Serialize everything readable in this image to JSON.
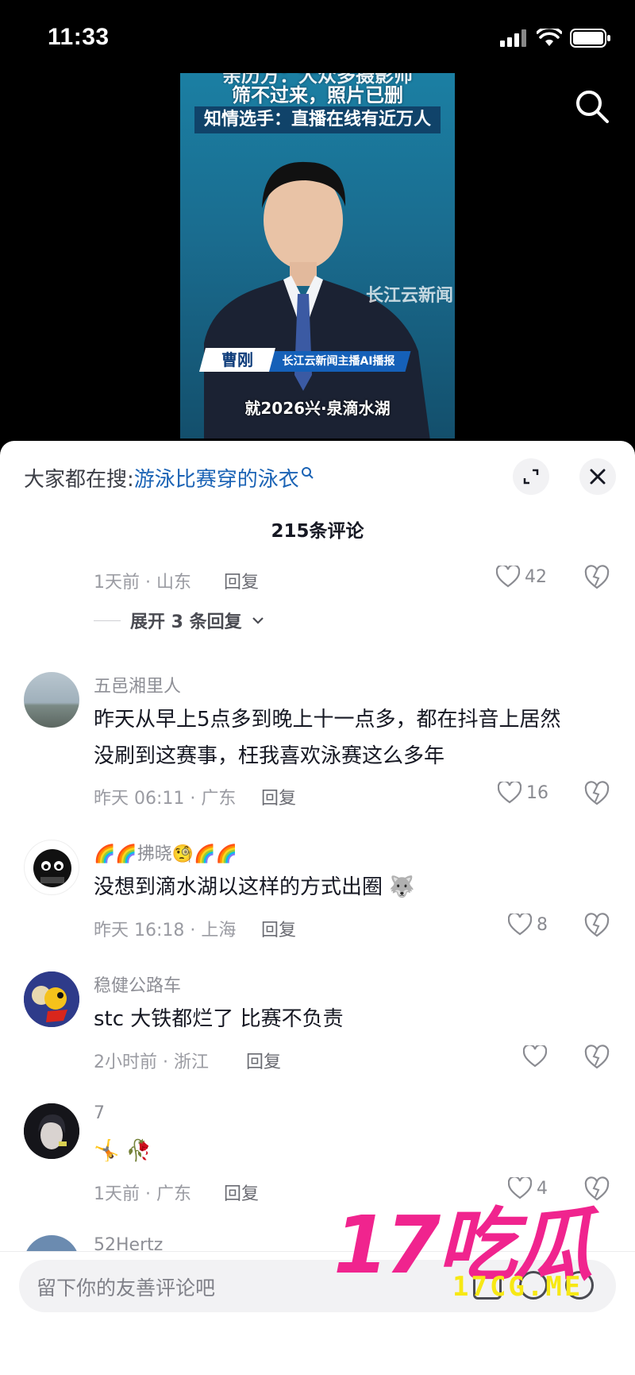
{
  "status": {
    "time": "11:33"
  },
  "video": {
    "title_line_clipped": "亲历方：大众多摄影师",
    "title_line_1": "筛不过来，照片已删",
    "title_line_2": "知情选手：直播在线有近万人",
    "watermark": "长江云新闻",
    "anchor_name": "曹刚",
    "anchor_org": "长江云新闻主播AI播报",
    "subtitle": "就2026兴·泉滴水湖"
  },
  "panel": {
    "suggest_prefix": "大家都在搜:",
    "suggest_query": "游泳比赛穿的泳衣",
    "comment_count": "215条评论"
  },
  "comments": [
    {
      "meta": "1天前 · 山东",
      "reply": "回复",
      "likes": "42",
      "expand": "展开 3 条回复"
    },
    {
      "username": "五邑湘里人",
      "text_1": "昨天从早上5点多到晚上十一点多，都在抖音上居然",
      "text_2": "没刷到这赛事，枉我喜欢泳赛这么多年",
      "meta": "昨天 06:11 · 广东",
      "reply": "回复",
      "likes": "16"
    },
    {
      "username": "🌈🌈拂晓🧐🌈🌈",
      "text_1": "没想到滴水湖以这样的方式出圈 🐺",
      "meta": "昨天 16:18 · 上海",
      "reply": "回复",
      "likes": "8"
    },
    {
      "username": "稳健公路车",
      "text_1": "stc 大铁都烂了  比赛不负责",
      "meta": "2小时前 · 浙江",
      "reply": "回复",
      "likes": ""
    },
    {
      "username": "7",
      "text_1": "🤸 🥀",
      "meta": "1天前 · 广东",
      "reply": "回复",
      "likes": "4"
    },
    {
      "username": "52Hertz"
    }
  ],
  "input": {
    "placeholder": "留下你的友善评论吧"
  },
  "watermark": {
    "main": "17吃瓜",
    "sub": "17CG.ME"
  },
  "colors": {
    "link": "#1b63b5",
    "watermark_pink": "#f0248e",
    "watermark_yellow": "#f7e814"
  }
}
